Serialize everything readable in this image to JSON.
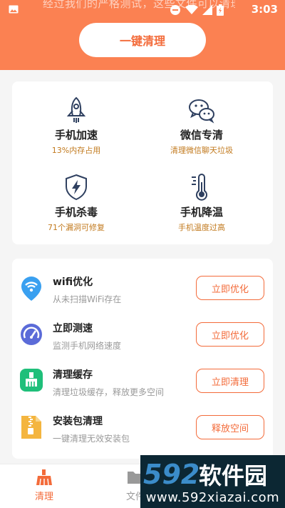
{
  "statusbar": {
    "marquee": "经过我们的严格测试，这些文件可以清理",
    "time": "3:03"
  },
  "header": {
    "clean_button": "一键清理"
  },
  "features": [
    {
      "title": "手机加速",
      "subtitle": "13%内存占用",
      "icon": "rocket-icon"
    },
    {
      "title": "微信专清",
      "subtitle": "清理微信聊天垃圾",
      "icon": "wechat-icon"
    },
    {
      "title": "手机杀毒",
      "subtitle": "71个漏洞可修复",
      "icon": "shield-icon"
    },
    {
      "title": "手机降温",
      "subtitle": "手机温度过高",
      "icon": "thermometer-icon"
    }
  ],
  "tools": [
    {
      "title": "wifi优化",
      "subtitle": "从未扫描WiFi存在",
      "button": "立即优化",
      "icon": "wifi-icon"
    },
    {
      "title": "立即测速",
      "subtitle": "监测手机网络速度",
      "button": "立即优化",
      "icon": "speedometer-icon"
    },
    {
      "title": "清理缓存",
      "subtitle": "清理垃圾缓存，释放更多空间",
      "button": "立即清理",
      "icon": "broom-icon"
    },
    {
      "title": "安装包清理",
      "subtitle": "一键清理无效安装包",
      "button": "释放空间",
      "icon": "zip-icon"
    }
  ],
  "bottom_nav": [
    {
      "label": "清理",
      "icon": "broom-icon",
      "active": true
    },
    {
      "label": "文件",
      "icon": "folder-icon",
      "active": false
    }
  ],
  "watermark": {
    "logo_text": "592软件园",
    "url": "www.592xiazai.com"
  },
  "colors": {
    "accent": "#fb8152",
    "button_text": "#f36b3a",
    "subtitle_gold": "#c27a1e",
    "icon_navy": "#2f4060"
  }
}
